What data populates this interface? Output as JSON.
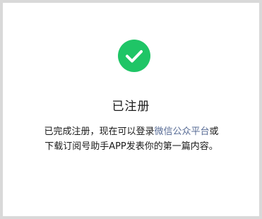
{
  "status": {
    "icon": "check-circle-icon",
    "accent_color": "#1fc566",
    "title": "已注册"
  },
  "message": {
    "prefix": "已完成注册，现在可以登录",
    "link_text": "微信公众平台",
    "link_color": "#576b95",
    "suffix": "或下载订阅号助手APP发表你的第一篇内容。"
  }
}
